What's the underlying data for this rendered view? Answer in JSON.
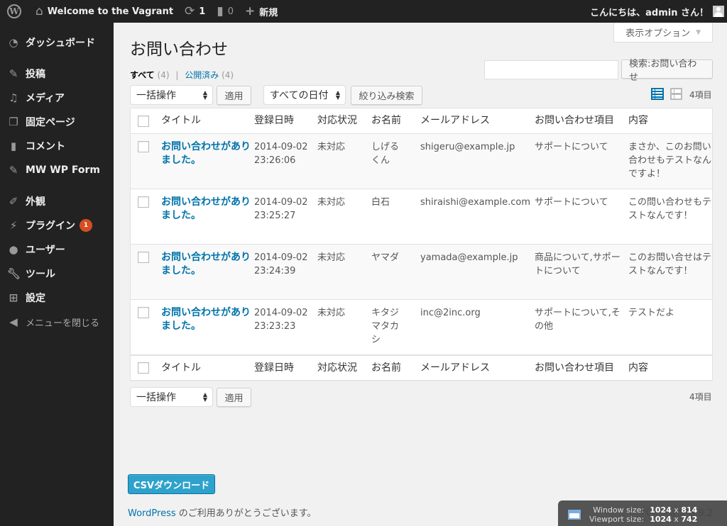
{
  "adminbar": {
    "logo": "wordpress-logo-icon",
    "site_name": "Welcome to the Vagrant",
    "updates_count": "1",
    "comments_count": "0",
    "new_label": "新規",
    "greeting": "こんにちは、admin さん！"
  },
  "sidebar": {
    "items": [
      {
        "label": "ダッシュボード",
        "icon": "dashboard-icon"
      },
      {
        "label": "投稿",
        "icon": "pin-icon"
      },
      {
        "label": "メディア",
        "icon": "media-icon"
      },
      {
        "label": "固定ページ",
        "icon": "pages-icon"
      },
      {
        "label": "コメント",
        "icon": "comment-icon"
      },
      {
        "label": "MW WP Form",
        "icon": "pin-icon"
      },
      {
        "label": "外観",
        "icon": "brush-icon"
      },
      {
        "label": "プラグイン",
        "icon": "plugin-icon",
        "badge": "1"
      },
      {
        "label": "ユーザー",
        "icon": "user-icon"
      },
      {
        "label": "ツール",
        "icon": "wrench-icon"
      },
      {
        "label": "設定",
        "icon": "settings-icon"
      },
      {
        "label": "メニューを閉じる",
        "icon": "collapse-icon"
      }
    ]
  },
  "screen_options": "表示オプション",
  "page_title": "お問い合わせ",
  "views": {
    "all_label": "すべて",
    "all_count": "(4)",
    "separator": "|",
    "published_label": "公開済み",
    "published_count": "(4)"
  },
  "search": {
    "value": "",
    "placeholder": "",
    "button": "検索:お問い合わせ"
  },
  "tablenav": {
    "bulk_action": "一括操作",
    "apply": "適用",
    "date_filter": "すべての日付",
    "filter_button": "絞り込み検索",
    "item_count": "4項目"
  },
  "table": {
    "columns": [
      "タイトル",
      "登録日時",
      "対応状況",
      "お名前",
      "メールアドレス",
      "お問い合わせ項目",
      "内容"
    ],
    "rows": [
      {
        "title": "お問い合わせがありました。",
        "date": "2014-09-02",
        "time": "23:26:06",
        "status": "未対応",
        "name": "しげるくん",
        "email": "shigeru@example.jp",
        "item": "サポートについて",
        "content": "まさか、このお問い合わせもテストなんですよ！"
      },
      {
        "title": "お問い合わせがありました。",
        "date": "2014-09-02",
        "time": "23:25:27",
        "status": "未対応",
        "name": "白石",
        "email": "shiraishi@example.com",
        "item": "サポートについて",
        "content": "この問い合わせもテストなんです！"
      },
      {
        "title": "お問い合わせがありました。",
        "date": "2014-09-02",
        "time": "23:24:39",
        "status": "未対応",
        "name": "ヤマダ",
        "email": "yamada@example.jp",
        "item": "商品について,サポートについて",
        "content": "このお問い合せはテストなんです！"
      },
      {
        "title": "お問い合わせがありました。",
        "date": "2014-09-02",
        "time": "23:23:23",
        "status": "未対応",
        "name": "キタジマタカシ",
        "email": "inc@2inc.org",
        "item": "サポートについて,その他",
        "content": "テストだよ"
      }
    ]
  },
  "csv_button": "CSVダウンロード",
  "footer": {
    "wp_link": "WordPress",
    "thanks": " のご利用ありがとうございます。",
    "version": "バージョン 3.9.2"
  },
  "size_overlay": {
    "window_label": "Window size:",
    "window_w": "1024",
    "window_h": "814",
    "viewport_label": "Viewport size:",
    "viewport_w": "1024",
    "viewport_h": "742"
  },
  "colors": {
    "link": "#0073aa",
    "adminbar_bg": "#222222",
    "primary_button": "#2ea2cc",
    "badge": "#d54e21"
  }
}
